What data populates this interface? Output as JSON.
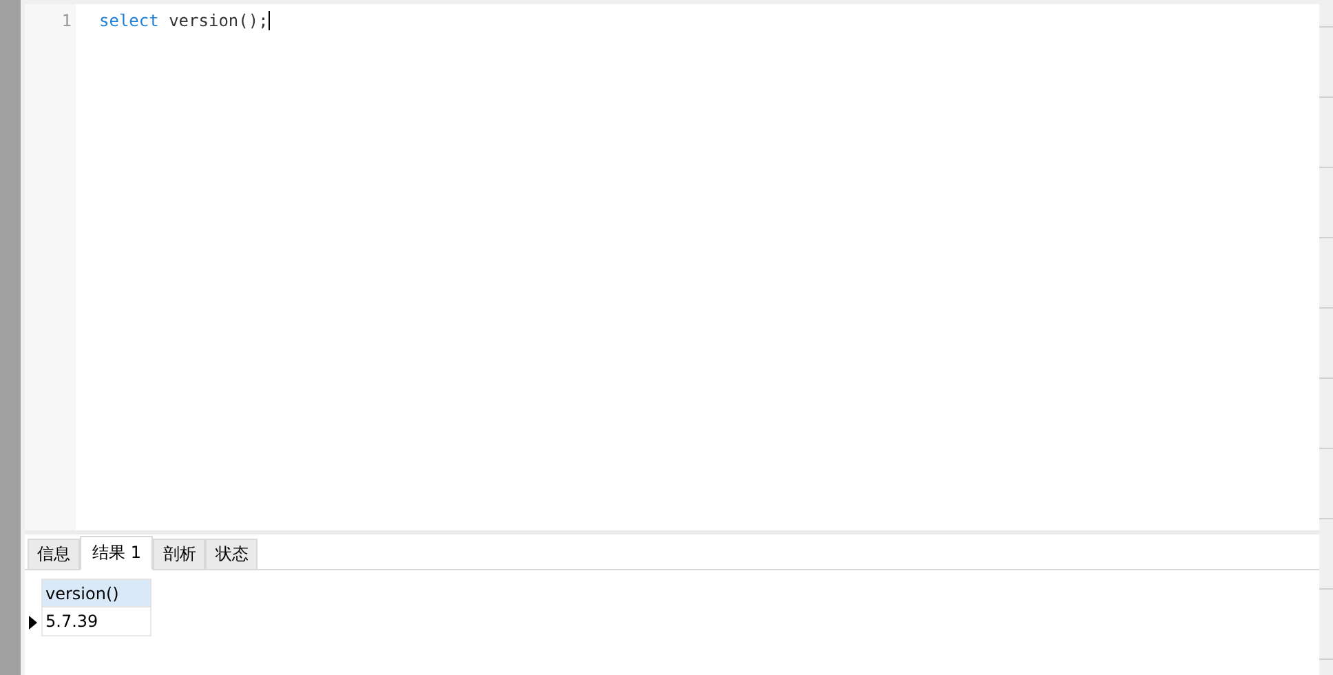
{
  "editor": {
    "lines": [
      {
        "number": "1",
        "keyword": "select",
        "rest": " version();"
      }
    ]
  },
  "result_tabs": [
    {
      "label": "信息",
      "selected": false
    },
    {
      "label": "结果 1",
      "selected": true
    },
    {
      "label": "剖析",
      "selected": false
    },
    {
      "label": "状态",
      "selected": false
    }
  ],
  "result_grid": {
    "columns": [
      "version()"
    ],
    "rows": [
      {
        "cells": [
          "5.7.39"
        ],
        "selected": true
      }
    ]
  }
}
